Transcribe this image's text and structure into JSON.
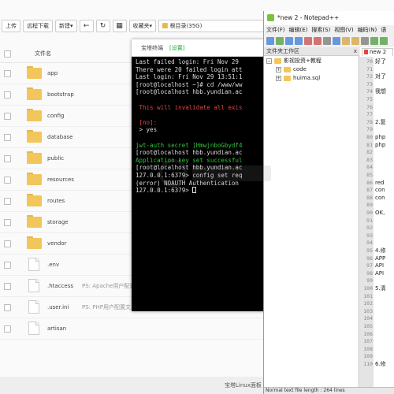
{
  "file_manager": {
    "toolbar": {
      "upload": "上传",
      "remote_download": "远程下载",
      "new": "新建",
      "favorites": "收藏夹",
      "path": "根目录(35G)"
    },
    "column_name": "文件名",
    "rows": [
      {
        "type": "folder",
        "name": "app",
        "ps": ""
      },
      {
        "type": "folder",
        "name": "bootstrap",
        "ps": ""
      },
      {
        "type": "folder",
        "name": "config",
        "ps": ""
      },
      {
        "type": "folder",
        "name": "database",
        "ps": ""
      },
      {
        "type": "folder",
        "name": "public",
        "ps": ""
      },
      {
        "type": "folder",
        "name": "resources",
        "ps": ""
      },
      {
        "type": "folder",
        "name": "routes",
        "ps": ""
      },
      {
        "type": "folder",
        "name": "storage",
        "ps": ""
      },
      {
        "type": "folder",
        "name": "vendor",
        "ps": ""
      },
      {
        "type": "file",
        "name": ".env",
        "ps": ""
      },
      {
        "type": "file",
        "name": ".htaccess",
        "ps": "PS: Apache用户配置"
      },
      {
        "type": "file",
        "name": ".user.ini",
        "ps": "PS: PHP用户配置文"
      },
      {
        "type": "file",
        "name": "artisan",
        "ps": ""
      }
    ],
    "footer": "宝塔Linux面板"
  },
  "terminal": {
    "title": "宝塔终端",
    "settings": "[设置]",
    "lines": [
      {
        "text": "Last failed login: Fri Nov 29",
        "color": "default"
      },
      {
        "text": "There were 20 failed login att",
        "color": "default"
      },
      {
        "text": "Last login: Fri Nov 29 13:51:1",
        "color": "default"
      },
      {
        "text": "[root@localhost ~]# cd /www/ww",
        "color": "default"
      },
      {
        "text": "[root@localhost hbb.yundian.ac",
        "color": "default"
      },
      {
        "text": "",
        "color": "default"
      },
      {
        "text": " This will invalidate all exis",
        "color": "red"
      },
      {
        "text": "",
        "color": "default"
      },
      {
        "text": " [no]:",
        "color": "red"
      },
      {
        "text": " > yes",
        "color": "default"
      },
      {
        "text": "",
        "color": "default"
      },
      {
        "text": "jwt-auth secret [HmwjnboGbydf4",
        "color": "green"
      },
      {
        "text": "[root@localhost hbb.yundian.ac",
        "color": "default"
      },
      {
        "text": "Application key set successful",
        "color": "green"
      },
      {
        "text": "[root@localhost hbb.yundian.ac",
        "color": "default"
      },
      {
        "text": "127.0.0.1:6379> config set req",
        "color": "default"
      },
      {
        "text": "(error) NOAUTH Authentication",
        "color": "default"
      },
      {
        "text": "127.0.0.1:6379> ",
        "color": "default",
        "cursor": true
      }
    ]
  },
  "notepad": {
    "title": "*new 2 - Notepad++",
    "menu": [
      "文件(F)",
      "编辑(E)",
      "搜索(S)",
      "视图(V)",
      "编码(N)",
      "语"
    ],
    "workspace_title": "文件夹工作区",
    "workspace_close": "x",
    "tree": [
      {
        "label": "影视投资+教程",
        "level": 0,
        "exp": "−"
      },
      {
        "label": "code",
        "level": 1,
        "exp": "+"
      },
      {
        "label": "huima.sql",
        "level": 1,
        "exp": "+"
      }
    ],
    "tab": "new 2",
    "lines": [
      {
        "n": "70",
        "t": "好了"
      },
      {
        "n": "71",
        "t": ""
      },
      {
        "n": "72",
        "t": "对了"
      },
      {
        "n": "73",
        "t": ""
      },
      {
        "n": "74",
        "t": "我想"
      },
      {
        "n": "75",
        "t": ""
      },
      {
        "n": "76",
        "t": ""
      },
      {
        "n": "77",
        "t": ""
      },
      {
        "n": "78",
        "t": "2.复"
      },
      {
        "n": "79",
        "t": ""
      },
      {
        "n": "80",
        "t": "php"
      },
      {
        "n": "81",
        "t": "php"
      },
      {
        "n": "82",
        "t": ""
      },
      {
        "n": "83",
        "t": ""
      },
      {
        "n": "84",
        "t": ""
      },
      {
        "n": "85",
        "t": ""
      },
      {
        "n": "86",
        "t": "red"
      },
      {
        "n": "87",
        "t": "con"
      },
      {
        "n": "88",
        "t": "con"
      },
      {
        "n": "89",
        "t": ""
      },
      {
        "n": "90",
        "t": "OK,"
      },
      {
        "n": "91",
        "t": ""
      },
      {
        "n": "92",
        "t": ""
      },
      {
        "n": "93",
        "t": ""
      },
      {
        "n": "94",
        "t": ""
      },
      {
        "n": "95",
        "t": "4.修"
      },
      {
        "n": "96",
        "t": "APP"
      },
      {
        "n": "97",
        "t": "API"
      },
      {
        "n": "98",
        "t": "API"
      },
      {
        "n": "99",
        "t": ""
      },
      {
        "n": "100",
        "t": "5.清"
      },
      {
        "n": "101",
        "t": ""
      },
      {
        "n": "102",
        "t": ""
      },
      {
        "n": "103",
        "t": ""
      },
      {
        "n": "104",
        "t": ""
      },
      {
        "n": "105",
        "t": ""
      },
      {
        "n": "106",
        "t": ""
      },
      {
        "n": "107",
        "t": ""
      },
      {
        "n": "108",
        "t": ""
      },
      {
        "n": "109",
        "t": ""
      },
      {
        "n": "110",
        "t": "6.修"
      }
    ],
    "status": "Normal text file length : 264 lines"
  },
  "colors": {
    "terminal_green": "#34c03a",
    "terminal_red": "#e04545",
    "folder": "#f2c65a",
    "bt_green": "#20a53a"
  }
}
